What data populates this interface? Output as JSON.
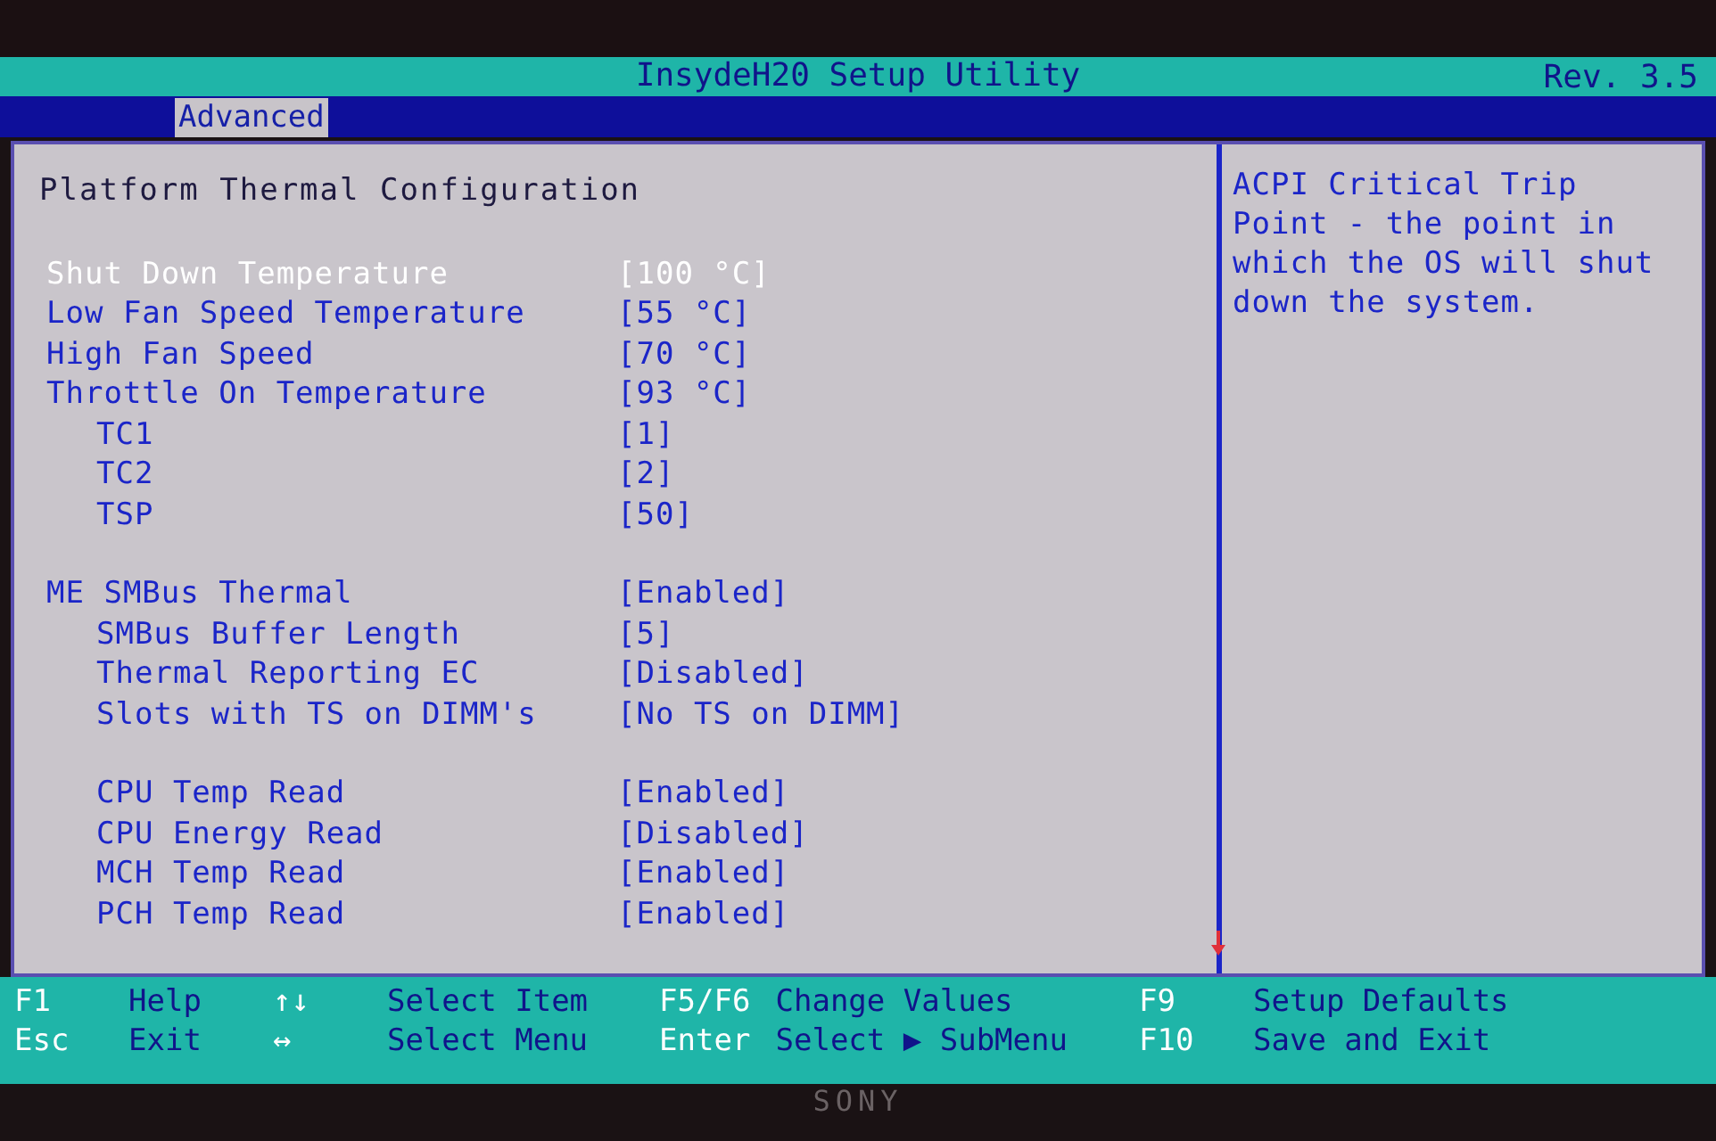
{
  "title_bar": {
    "title": "InsydeH20 Setup Utility",
    "revision": "Rev. 3.5"
  },
  "tabs": [
    {
      "label": "Advanced",
      "selected": true
    }
  ],
  "page_title": "Platform Thermal Configuration",
  "groups": [
    {
      "settings": [
        {
          "label": "Shut Down Temperature",
          "value": "[100 °C]",
          "kind": "main",
          "selected": true
        },
        {
          "label": "Low Fan Speed Temperature",
          "value": "[55 °C]",
          "kind": "main",
          "selected": false
        },
        {
          "label": "High Fan Speed",
          "value": "[70 °C]",
          "kind": "main",
          "selected": false
        },
        {
          "label": "Throttle On Temperature",
          "value": "[93 °C]",
          "kind": "main",
          "selected": false
        },
        {
          "label": "TC1",
          "value": "[1]",
          "kind": "sub",
          "selected": false
        },
        {
          "label": "TC2",
          "value": "[2]",
          "kind": "sub",
          "selected": false
        },
        {
          "label": "TSP",
          "value": "[50]",
          "kind": "sub",
          "selected": false
        }
      ]
    },
    {
      "settings": [
        {
          "label": "ME SMBus Thermal",
          "value": "[Enabled]",
          "kind": "main",
          "selected": false
        },
        {
          "label": "SMBus Buffer Length",
          "value": "[5]",
          "kind": "sub",
          "selected": false
        },
        {
          "label": "Thermal Reporting EC",
          "value": "[Disabled]",
          "kind": "sub",
          "selected": false
        },
        {
          "label": "Slots with TS on DIMM's",
          "value": "[No TS on DIMM]",
          "kind": "sub",
          "selected": false
        }
      ]
    },
    {
      "settings": [
        {
          "label": "CPU Temp Read",
          "value": "[Enabled]",
          "kind": "sub",
          "selected": false
        },
        {
          "label": "CPU Energy Read",
          "value": "[Disabled]",
          "kind": "sub",
          "selected": false
        },
        {
          "label": "MCH Temp Read",
          "value": "[Enabled]",
          "kind": "sub",
          "selected": false
        },
        {
          "label": "PCH Temp Read",
          "value": "[Enabled]",
          "kind": "sub",
          "selected": false
        }
      ]
    }
  ],
  "help_text": "ACPI Critical Trip Point - the point in which the OS will shut down the system.",
  "footer": [
    [
      {
        "key": "F1",
        "action": "Help"
      },
      {
        "key": "Esc",
        "action": "Exit"
      }
    ],
    [
      {
        "key": "↑↓",
        "action": "Select Item"
      },
      {
        "key": "↔",
        "action": "Select Menu"
      }
    ],
    [
      {
        "key": "F5/F6",
        "action": "Change Values"
      },
      {
        "key": "Enter",
        "action": "Select ▶ SubMenu"
      }
    ],
    [
      {
        "key": "F9",
        "action": "Setup Defaults"
      },
      {
        "key": "F10",
        "action": "Save and Exit"
      }
    ]
  ],
  "bezel_logo": "SONY"
}
